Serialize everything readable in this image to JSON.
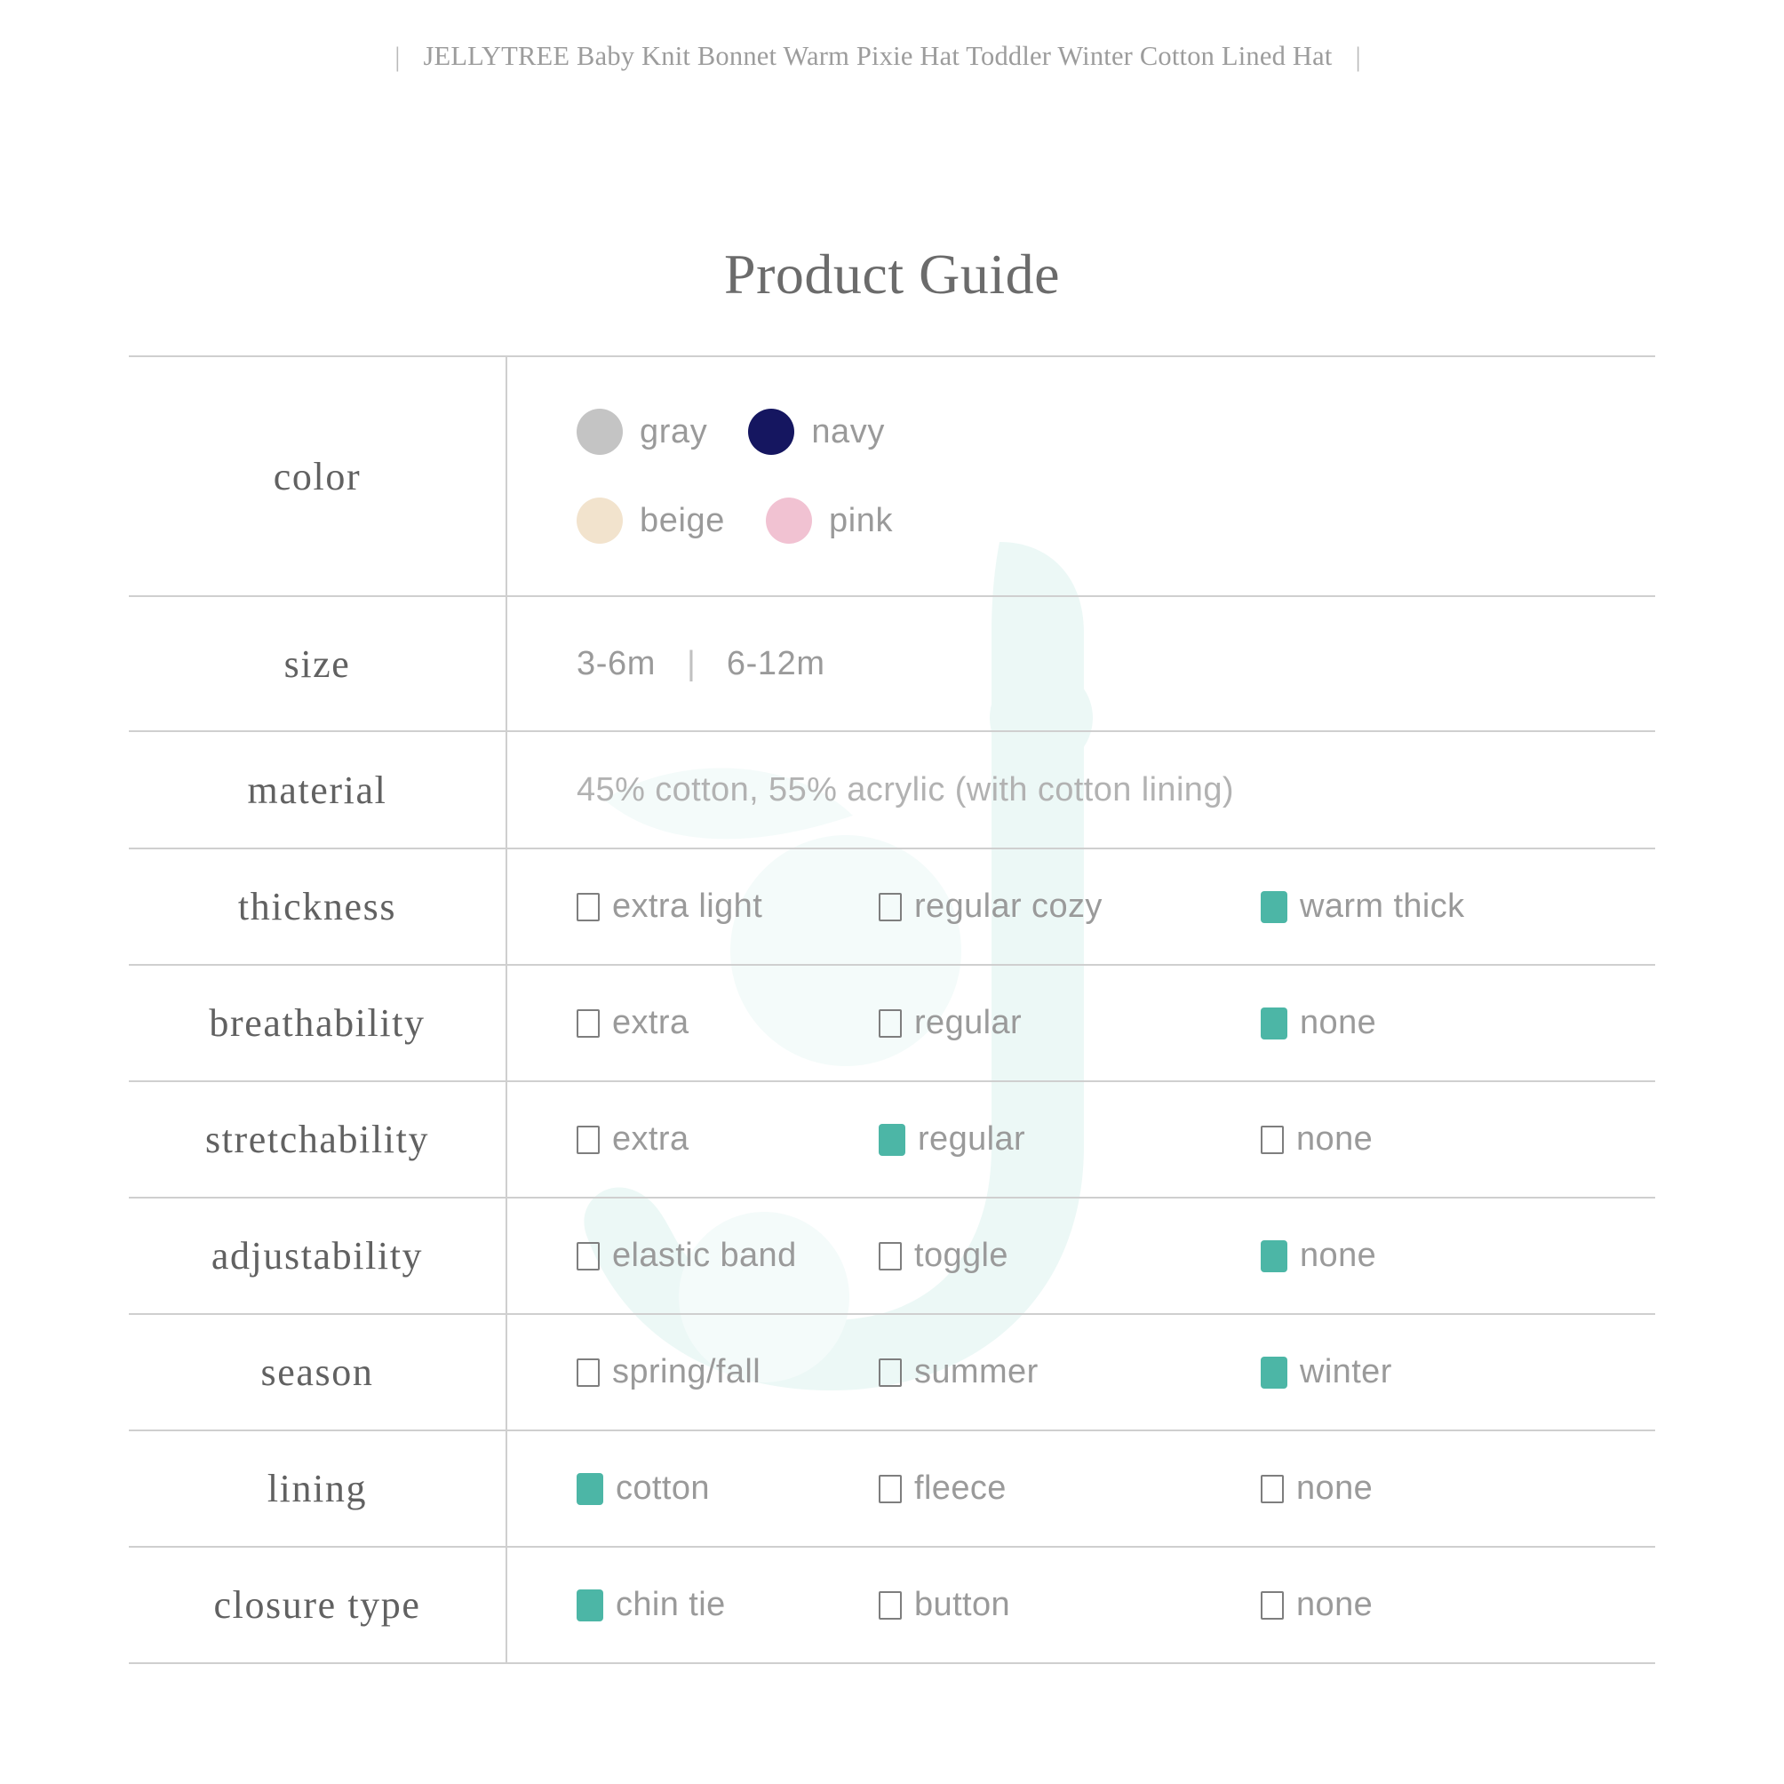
{
  "topbar": {
    "left_pipe": "|",
    "text": "JELLYTREE Baby Knit Bonnet Warm Pixie Hat Toddler Winter Cotton Lined Hat",
    "right_pipe": "|"
  },
  "title": "Product Guide",
  "theme": {
    "accent_teal": "#4cb6a6",
    "text_gray": "#9a9a9a",
    "label_gray": "#616161",
    "rule_gray": "#cfcfcf",
    "watermark_mint": "#eaf7f5"
  },
  "rows": {
    "color": {
      "label": "color",
      "swatches": [
        {
          "name": "gray",
          "hex": "#c4c4c4"
        },
        {
          "name": "navy",
          "hex": "#151660"
        },
        {
          "name": "beige",
          "hex": "#f2e3cd"
        },
        {
          "name": "pink",
          "hex": "#f1c2d2"
        }
      ]
    },
    "size": {
      "label": "size",
      "values": [
        "3-6m",
        "6-12m"
      ],
      "separator": "|"
    },
    "material": {
      "label": "material",
      "text": "45% cotton, 55% acrylic (with  cotton lining)"
    },
    "thickness": {
      "label": "thickness",
      "options": [
        {
          "text": "extra light",
          "checked": false
        },
        {
          "text": "regular cozy",
          "checked": false
        },
        {
          "text": "warm thick",
          "checked": true
        }
      ]
    },
    "breathability": {
      "label": "breathability",
      "options": [
        {
          "text": "extra",
          "checked": false
        },
        {
          "text": "regular",
          "checked": false
        },
        {
          "text": "none",
          "checked": true
        }
      ]
    },
    "stretchability": {
      "label": "stretchability",
      "options": [
        {
          "text": "extra",
          "checked": false
        },
        {
          "text": "regular",
          "checked": true
        },
        {
          "text": "none",
          "checked": false
        }
      ]
    },
    "adjustability": {
      "label": "adjustability",
      "options": [
        {
          "text": "elastic band",
          "checked": false
        },
        {
          "text": "toggle",
          "checked": false
        },
        {
          "text": "none",
          "checked": true
        }
      ]
    },
    "season": {
      "label": "season",
      "options": [
        {
          "text": "spring/fall",
          "checked": false
        },
        {
          "text": "summer",
          "checked": false
        },
        {
          "text": "winter",
          "checked": true
        }
      ]
    },
    "lining": {
      "label": "lining",
      "options": [
        {
          "text": "cotton",
          "checked": true
        },
        {
          "text": "fleece",
          "checked": false
        },
        {
          "text": "none",
          "checked": false
        }
      ]
    },
    "closure_type": {
      "label": "closure type",
      "options": [
        {
          "text": "chin tie",
          "checked": true
        },
        {
          "text": "button",
          "checked": false
        },
        {
          "text": "none",
          "checked": false
        }
      ]
    }
  }
}
